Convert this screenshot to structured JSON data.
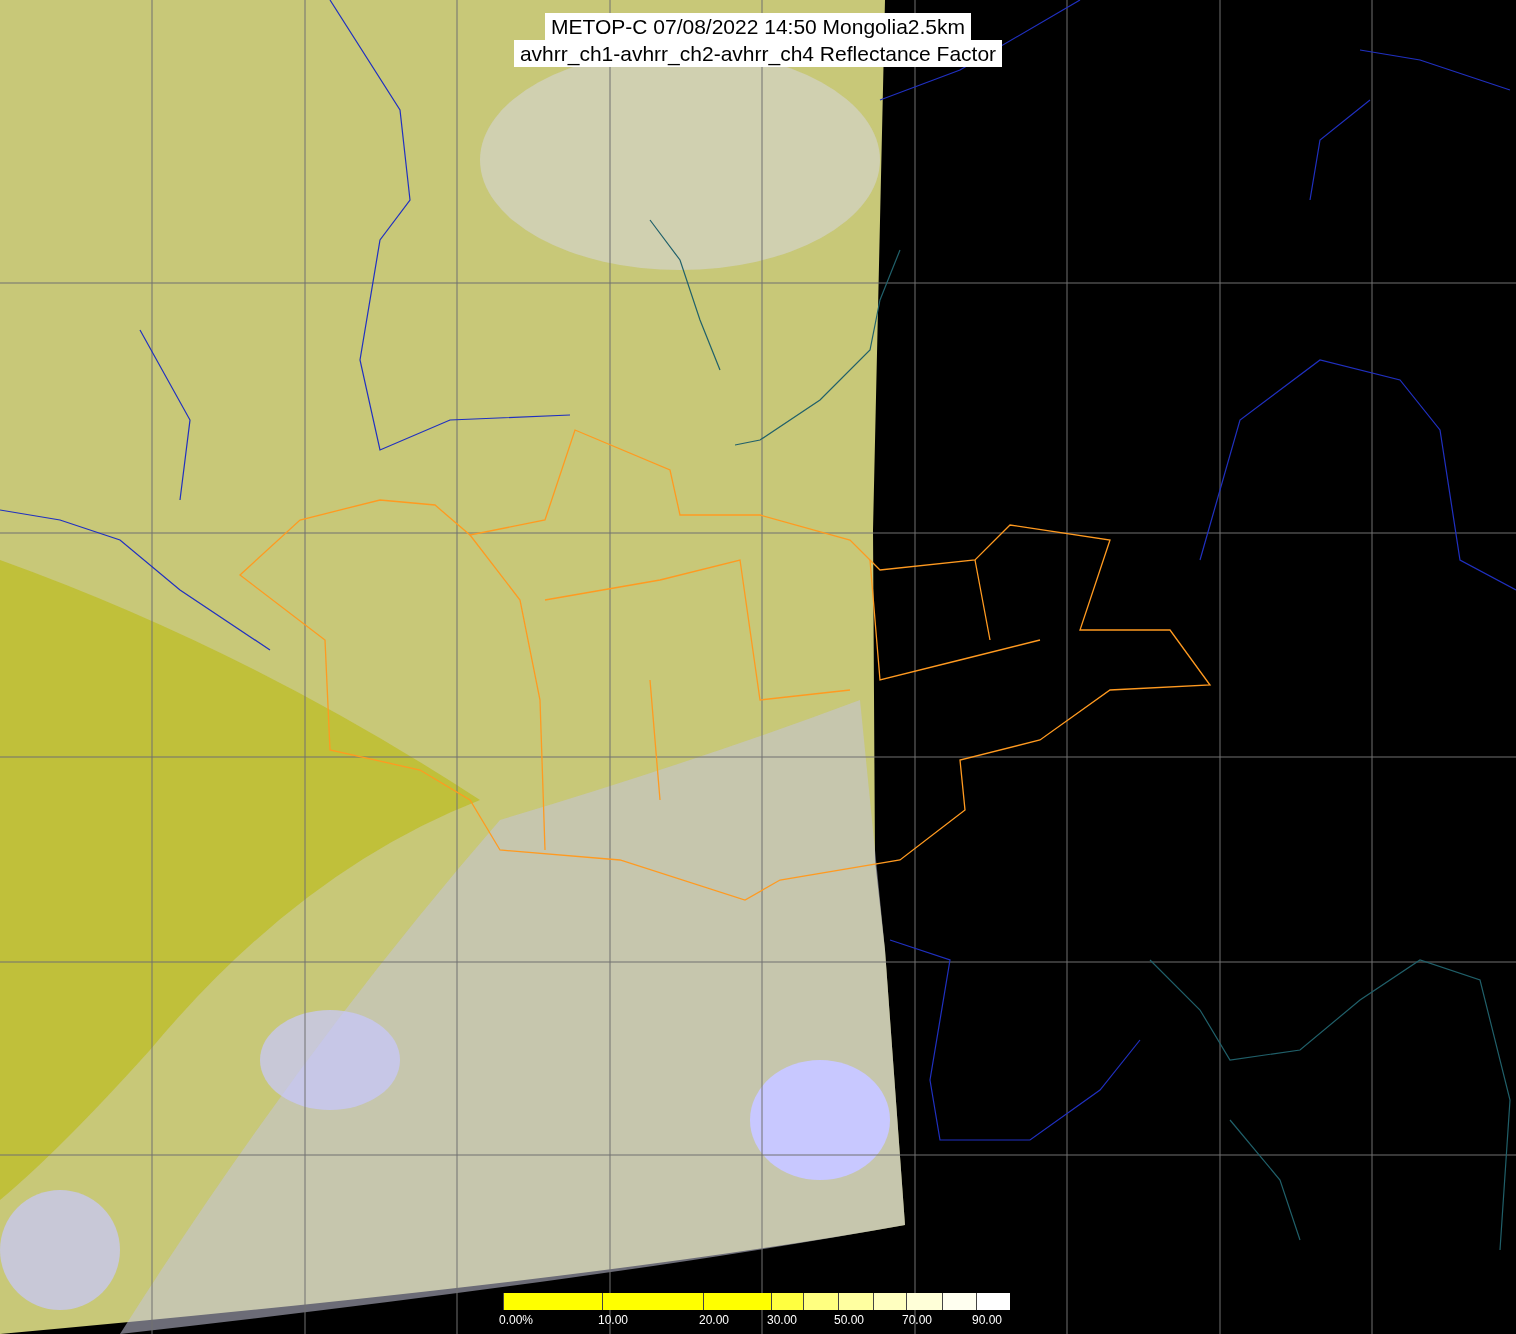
{
  "title": {
    "lines": [
      "METOP-C 07/08/2022 14:50 Mongolia2.5km",
      "avhrr_ch1-avhrr_ch2-avhrr_ch4 Reflectance Factor"
    ]
  },
  "colorbar": {
    "segments": [
      {
        "color": "#ffff00",
        "label": "0.00%"
      },
      {
        "color": "#ffff00",
        "label": "10.00"
      },
      {
        "color": "#ffff00",
        "label": "20.00"
      },
      {
        "color": "#ffff40",
        "label": "30.00"
      },
      {
        "color": "#ffff80"
      },
      {
        "color": "#ffffa0",
        "label": "50.00"
      },
      {
        "color": "#ffffc0"
      },
      {
        "color": "#ffffd8",
        "label": "70.00"
      },
      {
        "color": "#fffff0"
      },
      {
        "color": "#ffffff",
        "label": "90.00"
      }
    ]
  }
}
